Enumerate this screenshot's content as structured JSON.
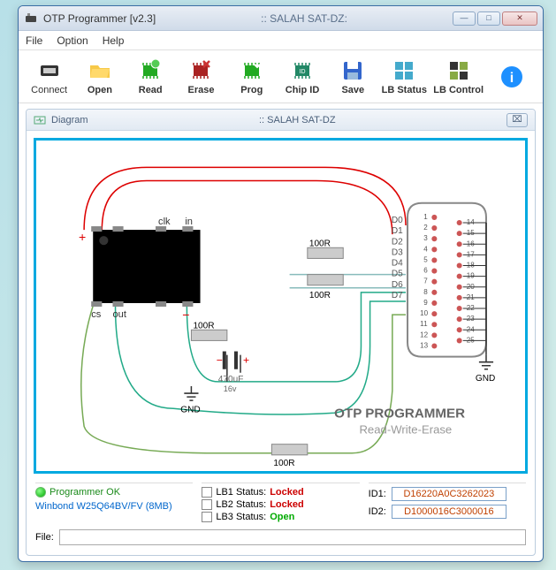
{
  "window": {
    "title": "OTP Programmer [v2.3]",
    "subtitle": ":: SALAH SAT-DZ:"
  },
  "menu": {
    "file": "File",
    "option": "Option",
    "help": "Help"
  },
  "toolbar": {
    "connect": "Connect",
    "open": "Open",
    "read": "Read",
    "erase": "Erase",
    "prog": "Prog",
    "chipid": "Chip ID",
    "save": "Save",
    "lbstatus": "LB Status",
    "lbcontrol": "LB Control"
  },
  "diagram": {
    "title_left": "Diagram",
    "title_center": ":: SALAH SAT-DZ",
    "labels": {
      "clk": "clk",
      "in": "in",
      "cs": "cs",
      "out": "out",
      "r1": "100R",
      "r2": "100R",
      "r3": "100R",
      "r4": "100R",
      "cap": "470uF",
      "cap_v": "16v",
      "gnd1": "GND",
      "gnd2": "GND",
      "d0": "D0",
      "d1": "D1",
      "d2": "D2",
      "d3": "D3",
      "d4": "D4",
      "d5": "D5",
      "d6": "D6",
      "d7": "D7",
      "p14": "14",
      "p15": "15",
      "p16": "16",
      "p17": "17",
      "p18": "18",
      "p19": "19",
      "p20": "20",
      "p21": "21",
      "p22": "22",
      "p23": "23",
      "p24": "24",
      "p25": "25",
      "p1": "1",
      "p2": "2",
      "p3": "3",
      "p4": "4",
      "p5": "5",
      "p6": "6",
      "p7": "7",
      "p8": "8",
      "p9": "9",
      "p10": "10",
      "p11": "11",
      "p12": "12",
      "p13": "13",
      "title": "OTP PROGRAMMER",
      "subtitle": "Read-Write-Erase"
    }
  },
  "status": {
    "programmer": "Programmer OK",
    "chip": "Winbond W25Q64BV/FV (8MB)"
  },
  "lb": {
    "s1_label": "LB1 Status:",
    "s1_value": "Locked",
    "s2_label": "LB2 Status:",
    "s2_value": "Locked",
    "s3_label": "LB3 Status:",
    "s3_value": "Open"
  },
  "ids": {
    "id1_label": "ID1:",
    "id1_value": "D16220A0C3262023",
    "id2_label": "ID2:",
    "id2_value": "D1000016C3000016"
  },
  "file": {
    "label": "File:",
    "value": ""
  }
}
